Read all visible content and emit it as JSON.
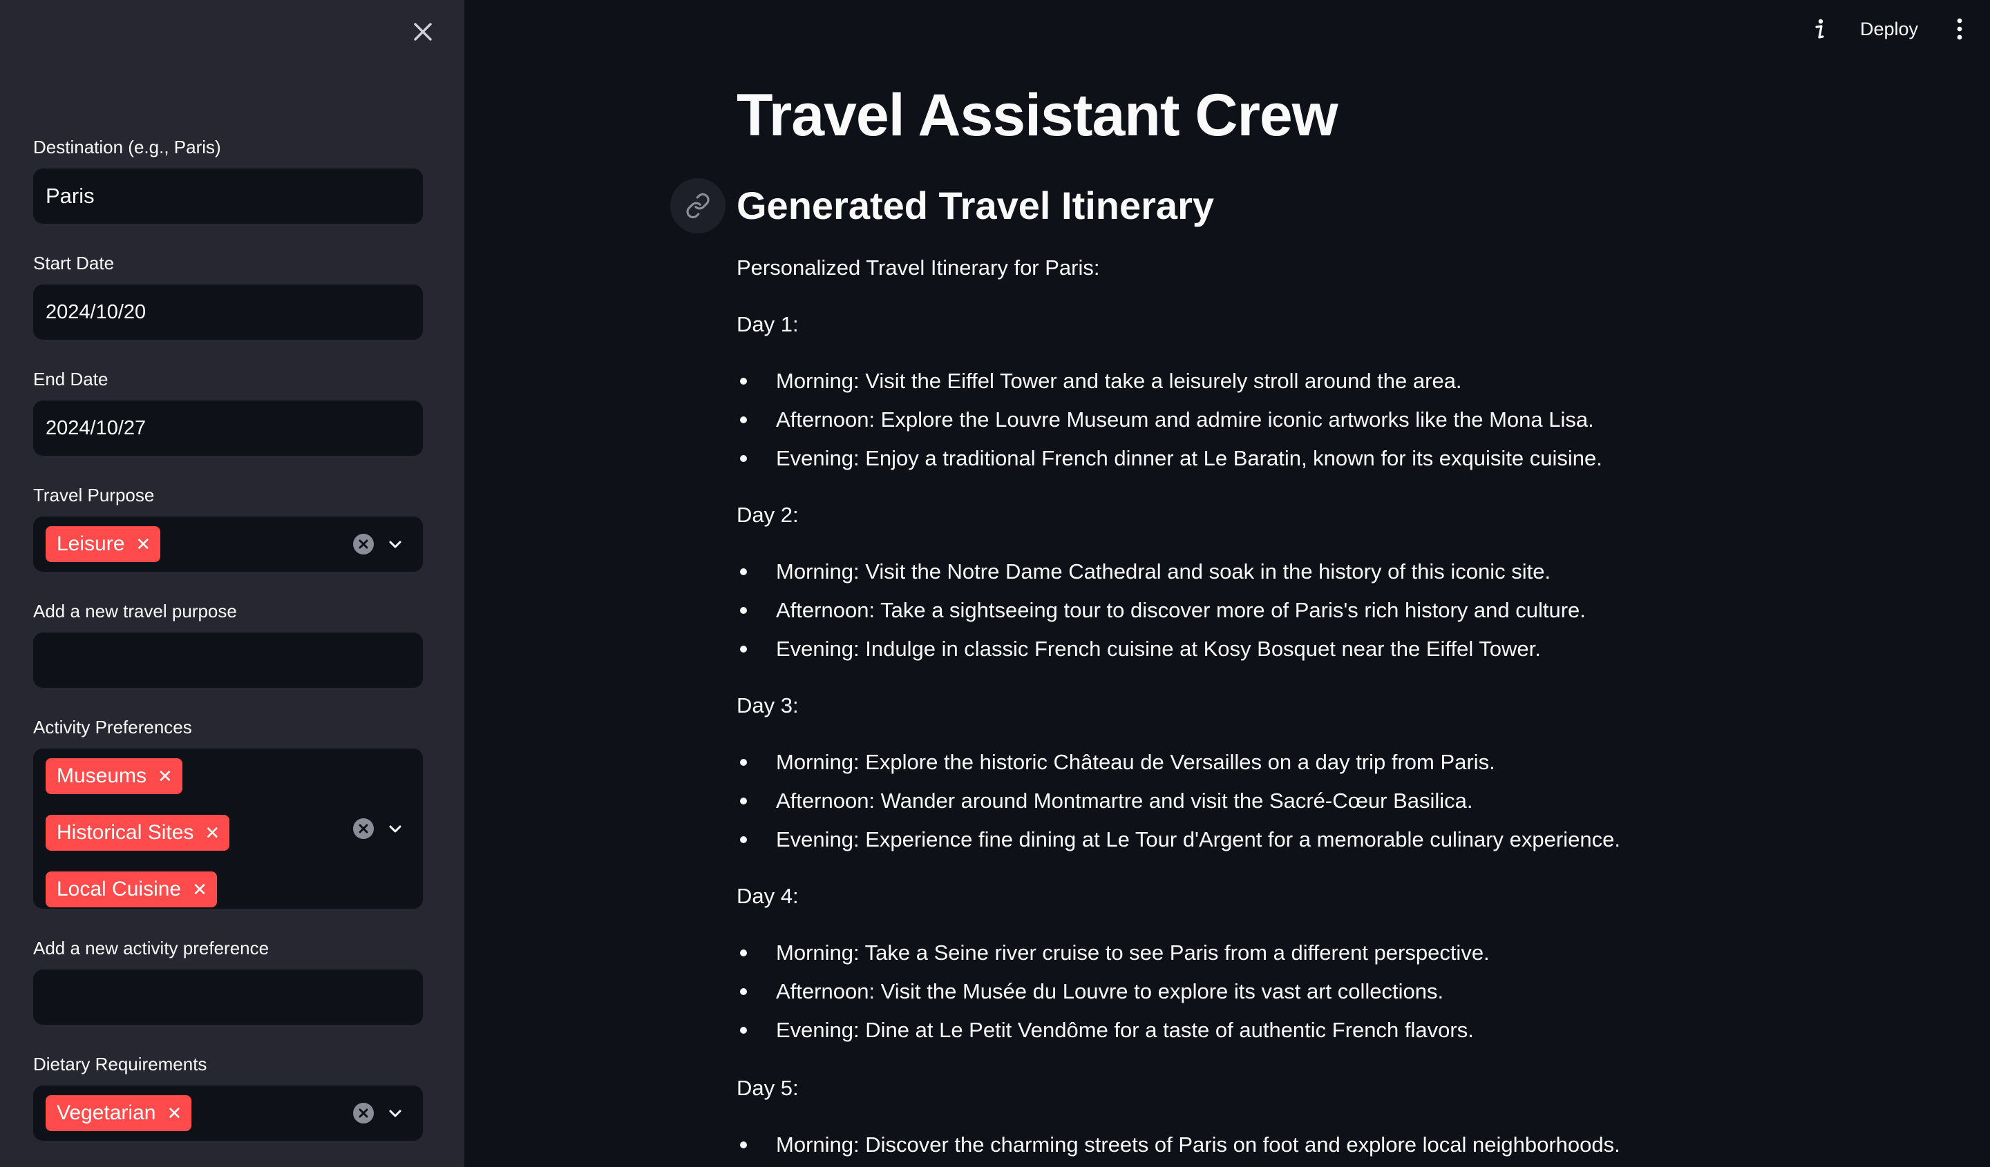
{
  "sidebar": {
    "destination": {
      "label": "Destination (e.g., Paris)",
      "value": "Paris"
    },
    "start_date": {
      "label": "Start Date",
      "value": "2024/10/20"
    },
    "end_date": {
      "label": "End Date",
      "value": "2024/10/27"
    },
    "travel_purpose": {
      "label": "Travel Purpose",
      "chips": [
        "Leisure"
      ]
    },
    "new_travel_purpose": {
      "label": "Add a new travel purpose",
      "value": ""
    },
    "activity_preferences": {
      "label": "Activity Preferences",
      "chips": [
        "Museums",
        "Historical Sites",
        "Local Cuisine"
      ]
    },
    "new_activity_preference": {
      "label": "Add a new activity preference",
      "value": ""
    },
    "dietary_requirements": {
      "label": "Dietary Requirements",
      "chips": [
        "Vegetarian"
      ]
    },
    "chip_remove_glyph": "✕"
  },
  "toolbar": {
    "deploy_label": "Deploy"
  },
  "main": {
    "title": "Travel Assistant Crew",
    "subtitle": "Generated Travel Itinerary",
    "intro": "Personalized Travel Itinerary for Paris:",
    "days": [
      {
        "label": "Day 1:",
        "items": [
          "Morning: Visit the Eiffel Tower and take a leisurely stroll around the area.",
          "Afternoon: Explore the Louvre Museum and admire iconic artworks like the Mona Lisa.",
          "Evening: Enjoy a traditional French dinner at Le Baratin, known for its exquisite cuisine."
        ]
      },
      {
        "label": "Day 2:",
        "items": [
          "Morning: Visit the Notre Dame Cathedral and soak in the history of this iconic site.",
          "Afternoon: Take a sightseeing tour to discover more of Paris's rich history and culture.",
          "Evening: Indulge in classic French cuisine at Kosy Bosquet near the Eiffel Tower."
        ]
      },
      {
        "label": "Day 3:",
        "items": [
          "Morning: Explore the historic Château de Versailles on a day trip from Paris.",
          "Afternoon: Wander around Montmartre and visit the Sacré-Cœur Basilica.",
          "Evening: Experience fine dining at Le Tour d'Argent for a memorable culinary experience."
        ]
      },
      {
        "label": "Day 4:",
        "items": [
          "Morning: Take a Seine river cruise to see Paris from a different perspective.",
          "Afternoon: Visit the Musée du Louvre to explore its vast art collections.",
          "Evening: Dine at Le Petit Vendôme for a taste of authentic French flavors."
        ]
      },
      {
        "label": "Day 5:",
        "items": [
          "Morning: Discover the charming streets of Paris on foot and explore local neighborhoods."
        ]
      }
    ]
  }
}
